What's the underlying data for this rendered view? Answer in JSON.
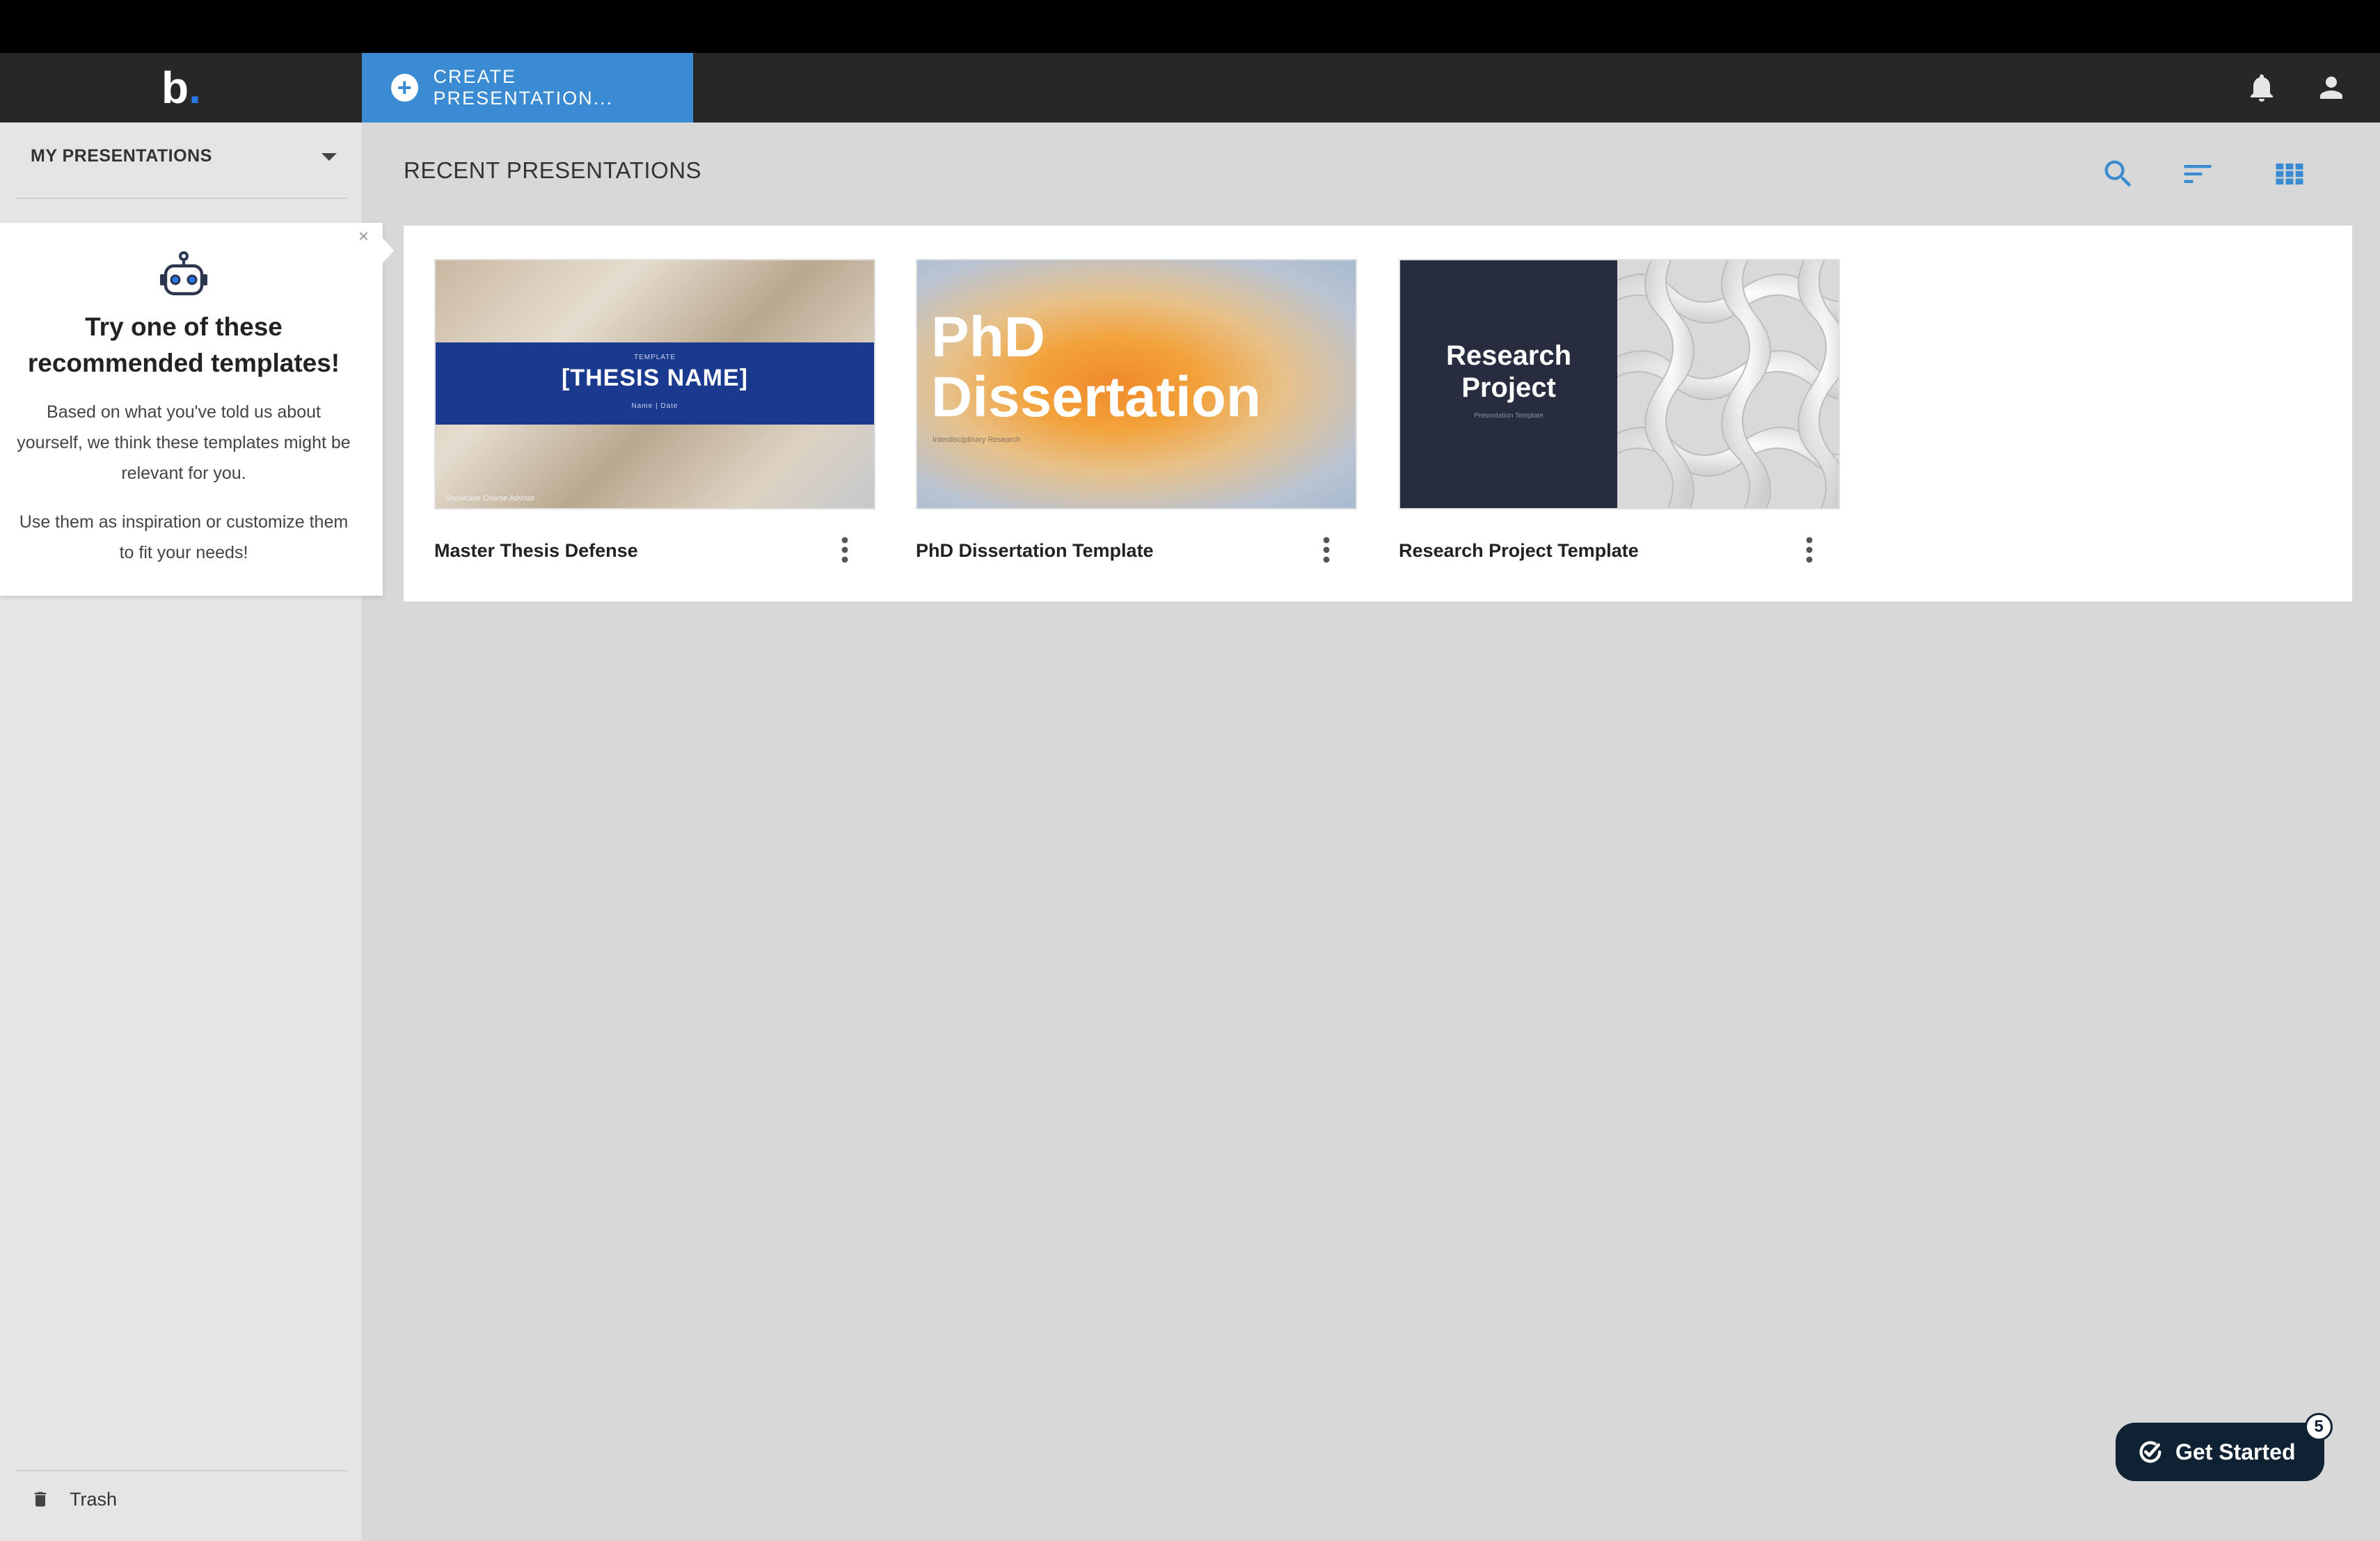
{
  "header": {
    "logo_text": "b",
    "logo_dot": ".",
    "create_label": "CREATE PRESENTATION...",
    "icons": [
      "bell-icon",
      "user-icon"
    ]
  },
  "sidebar": {
    "dropdown_label": "MY PRESENTATIONS",
    "trash_label": "Trash"
  },
  "popover": {
    "title": "Try one of these recommended templates!",
    "body1": "Based on what you've told us about yourself, we think these templates might be relevant for you.",
    "body2": "Use them as inspiration or customize them to fit your needs!",
    "close_symbol": "×",
    "icon": "robot-icon"
  },
  "main": {
    "section_title": "RECENT PRESENTATIONS",
    "tools": [
      "search-icon",
      "sort-icon",
      "grid-view-icon"
    ],
    "accent_color": "#3a8bd1"
  },
  "cards": [
    {
      "title": "Master Thesis Defense",
      "thumb_small": "TEMPLATE",
      "thumb_big": "[THESIS NAME]",
      "thumb_sub": "Name | Date",
      "thumb_foot": "Showcase Course Advisor"
    },
    {
      "title": "PhD Dissertation Template",
      "thumb_line1": "PhD",
      "thumb_line2": "Dissertation",
      "thumb_sub": "Interdisciplinary Research"
    },
    {
      "title": "Research Project Template",
      "thumb_line1": "Research",
      "thumb_line2": "Project",
      "thumb_sub": "Presentation Template"
    }
  ],
  "get_started": {
    "label": "Get Started",
    "badge": "5"
  }
}
